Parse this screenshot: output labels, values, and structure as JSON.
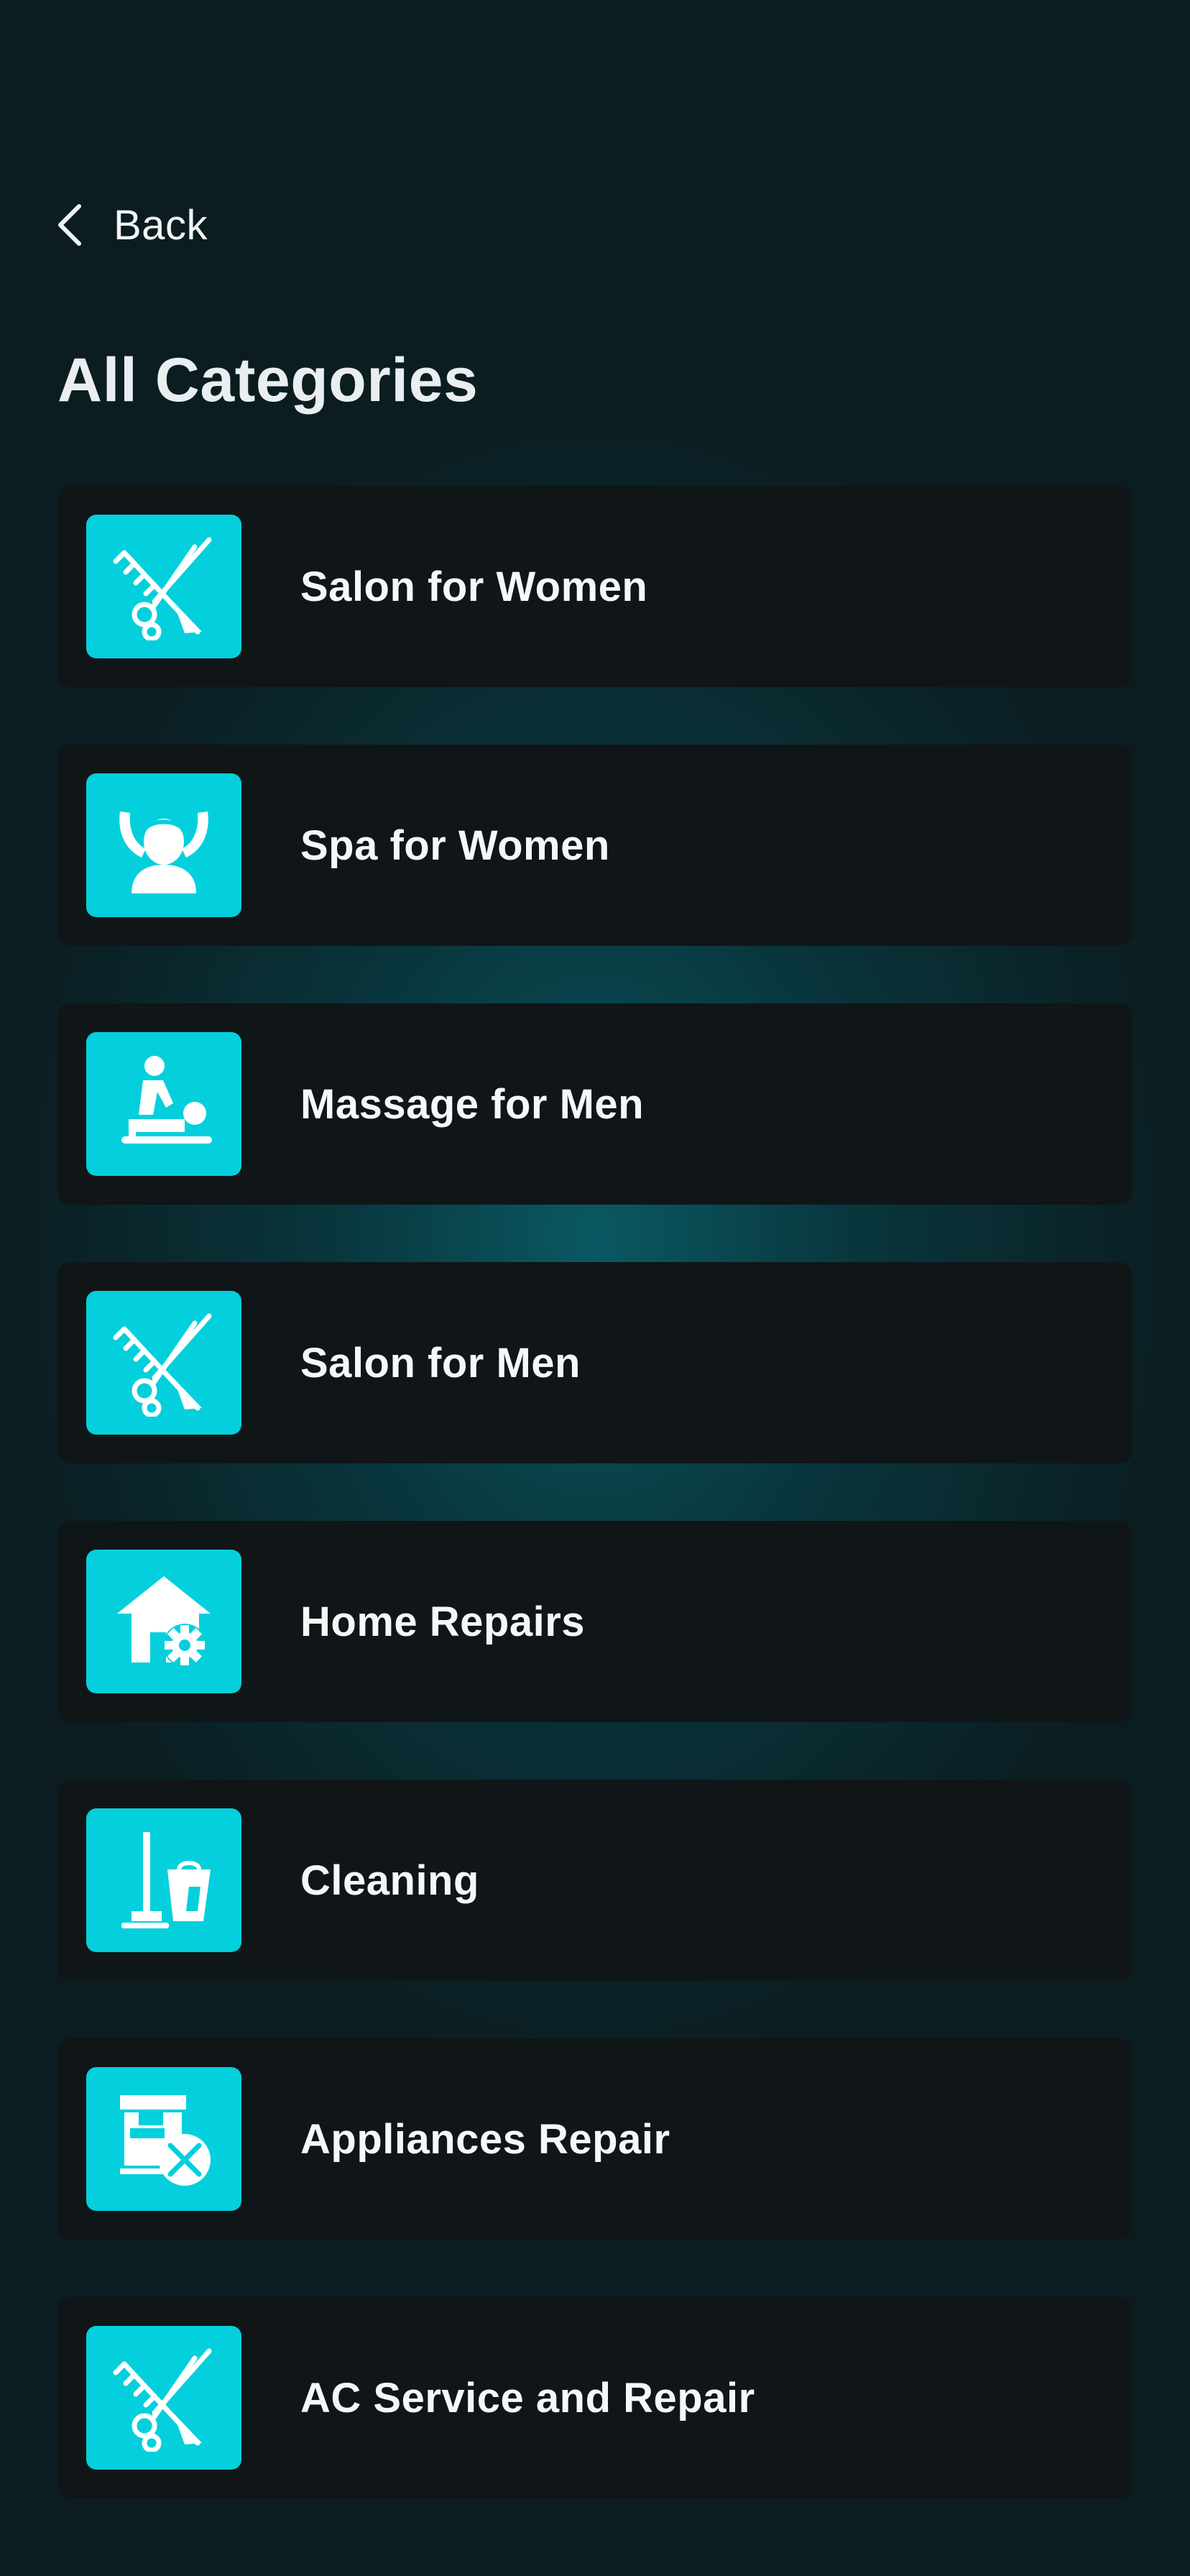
{
  "header": {
    "back_label": "Back",
    "back_icon": "chevron-left-icon",
    "title": "All Categories"
  },
  "categories": [
    {
      "label": "Salon for Women",
      "icon": "scissors-comb-icon"
    },
    {
      "label": "Spa for Women",
      "icon": "face-spa-icon"
    },
    {
      "label": "Massage for Men",
      "icon": "massage-icon"
    },
    {
      "label": "Salon for Men",
      "icon": "scissors-comb-icon"
    },
    {
      "label": "Home Repairs",
      "icon": "house-gear-icon"
    },
    {
      "label": "Cleaning",
      "icon": "mop-bucket-icon"
    },
    {
      "label": "Appliances Repair",
      "icon": "appliance-tools-icon"
    },
    {
      "label": "AC Service and Repair",
      "icon": "scissors-comb-icon"
    }
  ],
  "colors": {
    "background": "#0b1d21",
    "glow": "#0a5c66",
    "card": "#101517",
    "accent": "#03d0dc",
    "text": "#f5f7f8"
  }
}
